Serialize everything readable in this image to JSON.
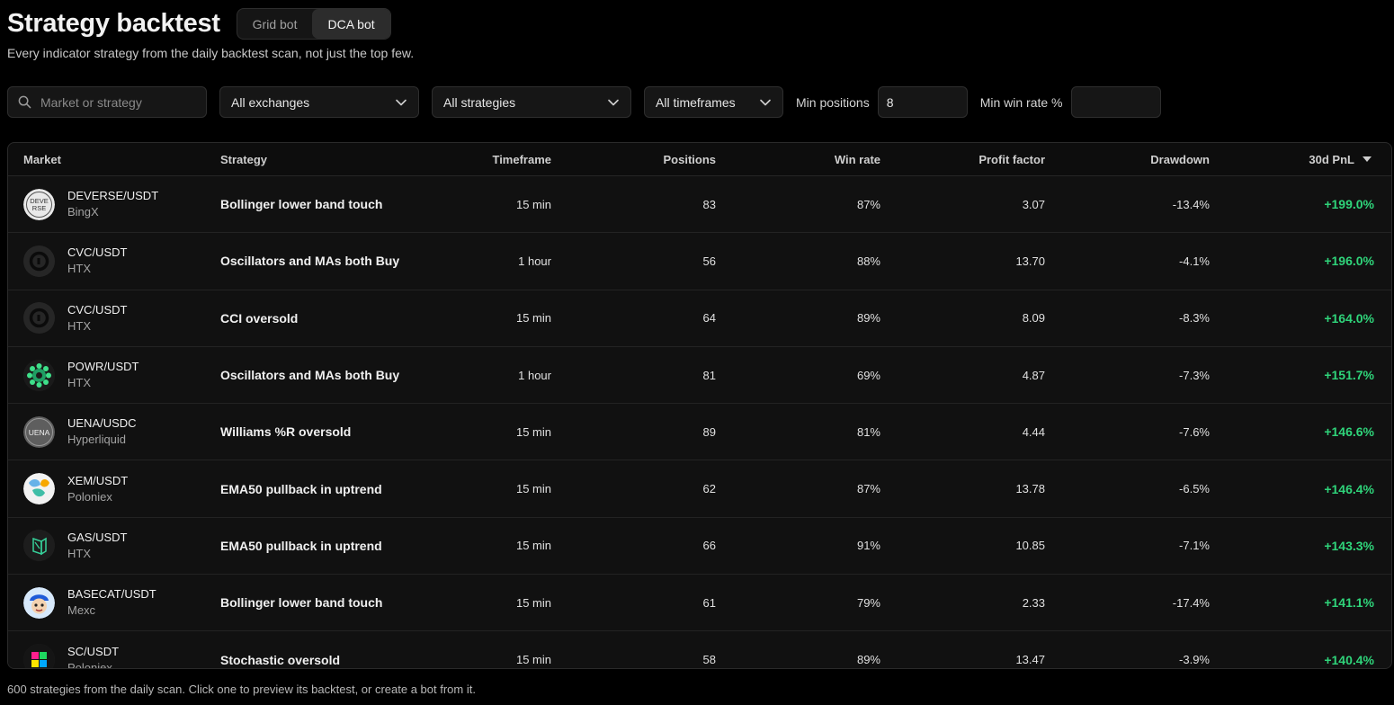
{
  "header": {
    "title": "Strategy backtest",
    "modes": [
      {
        "label": "Grid bot",
        "active": false
      },
      {
        "label": "DCA bot",
        "active": true
      }
    ],
    "subtitle": "Every indicator strategy from the daily backtest scan, not just the top few."
  },
  "filters": {
    "search_placeholder": "Market or strategy",
    "exchange": "All exchanges",
    "strategy": "All strategies",
    "timeframe": "All timeframes",
    "min_positions_label": "Min positions",
    "min_positions_value": "8",
    "min_win_rate_label": "Min win rate %",
    "min_win_rate_value": ""
  },
  "table": {
    "columns": {
      "market": "Market",
      "strategy": "Strategy",
      "timeframe": "Timeframe",
      "positions": "Positions",
      "win_rate": "Win rate",
      "profit_factor": "Profit factor",
      "drawdown": "Drawdown",
      "pnl": "30d PnL"
    },
    "sort_column": "30d PnL",
    "sort_direction": "descending",
    "rows": [
      {
        "pair": "DEVERSE/USDT",
        "exchange": "BingX",
        "icon": "deverse-icon",
        "strategy": "Bollinger lower band touch",
        "timeframe": "15 min",
        "positions": "83",
        "win_rate": "87%",
        "profit_factor": "3.07",
        "drawdown": "-13.4%",
        "pnl": "+199.0%"
      },
      {
        "pair": "CVC/USDT",
        "exchange": "HTX",
        "icon": "cvc-icon",
        "strategy": "Oscillators and MAs both Buy",
        "timeframe": "1 hour",
        "positions": "56",
        "win_rate": "88%",
        "profit_factor": "13.70",
        "drawdown": "-4.1%",
        "pnl": "+196.0%"
      },
      {
        "pair": "CVC/USDT",
        "exchange": "HTX",
        "icon": "cvc-icon",
        "strategy": "CCI oversold",
        "timeframe": "15 min",
        "positions": "64",
        "win_rate": "89%",
        "profit_factor": "8.09",
        "drawdown": "-8.3%",
        "pnl": "+164.0%"
      },
      {
        "pair": "POWR/USDT",
        "exchange": "HTX",
        "icon": "powr-icon",
        "strategy": "Oscillators and MAs both Buy",
        "timeframe": "1 hour",
        "positions": "81",
        "win_rate": "69%",
        "profit_factor": "4.87",
        "drawdown": "-7.3%",
        "pnl": "+151.7%"
      },
      {
        "pair": "UENA/USDC",
        "exchange": "Hyperliquid",
        "icon": "uena-icon",
        "strategy": "Williams %R oversold",
        "timeframe": "15 min",
        "positions": "89",
        "win_rate": "81%",
        "profit_factor": "4.44",
        "drawdown": "-7.6%",
        "pnl": "+146.6%"
      },
      {
        "pair": "XEM/USDT",
        "exchange": "Poloniex",
        "icon": "xem-icon",
        "strategy": "EMA50 pullback in uptrend",
        "timeframe": "15 min",
        "positions": "62",
        "win_rate": "87%",
        "profit_factor": "13.78",
        "drawdown": "-6.5%",
        "pnl": "+146.4%"
      },
      {
        "pair": "GAS/USDT",
        "exchange": "HTX",
        "icon": "gas-icon",
        "strategy": "EMA50 pullback in uptrend",
        "timeframe": "15 min",
        "positions": "66",
        "win_rate": "91%",
        "profit_factor": "10.85",
        "drawdown": "-7.1%",
        "pnl": "+143.3%"
      },
      {
        "pair": "BASECAT/USDT",
        "exchange": "Mexc",
        "icon": "basecat-icon",
        "strategy": "Bollinger lower band touch",
        "timeframe": "15 min",
        "positions": "61",
        "win_rate": "79%",
        "profit_factor": "2.33",
        "drawdown": "-17.4%",
        "pnl": "+141.1%"
      },
      {
        "pair": "SC/USDT",
        "exchange": "Poloniex",
        "icon": "sc-icon",
        "strategy": "Stochastic oversold",
        "timeframe": "15 min",
        "positions": "58",
        "win_rate": "89%",
        "profit_factor": "13.47",
        "drawdown": "-3.9%",
        "pnl": "+140.4%"
      }
    ]
  },
  "footer": {
    "text": "600 strategies from the daily scan. Click one to preview its backtest, or create a bot from it."
  },
  "colors": {
    "background": "#000000",
    "positive": "#2fd47a",
    "panel": "#111111",
    "border": "#2a2a2a"
  }
}
